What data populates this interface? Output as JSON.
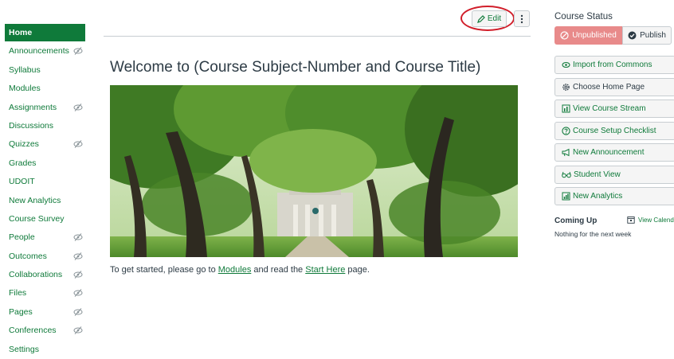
{
  "sidebar": {
    "items": [
      {
        "label": "Home",
        "active": true,
        "hidden": false
      },
      {
        "label": "Announcements",
        "hidden": true
      },
      {
        "label": "Syllabus",
        "hidden": false
      },
      {
        "label": "Modules",
        "hidden": false
      },
      {
        "label": "Assignments",
        "hidden": true
      },
      {
        "label": "Discussions",
        "hidden": false
      },
      {
        "label": "Quizzes",
        "hidden": true
      },
      {
        "label": "Grades",
        "hidden": false
      },
      {
        "label": "UDOIT",
        "hidden": false
      },
      {
        "label": "New Analytics",
        "hidden": false
      },
      {
        "label": "Course Survey",
        "hidden": false
      },
      {
        "label": "People",
        "hidden": true
      },
      {
        "label": "Outcomes",
        "hidden": true
      },
      {
        "label": "Collaborations",
        "hidden": true
      },
      {
        "label": "Files",
        "hidden": true
      },
      {
        "label": "Pages",
        "hidden": true
      },
      {
        "label": "Conferences",
        "hidden": true
      },
      {
        "label": "Settings",
        "hidden": false
      }
    ]
  },
  "toolbar": {
    "edit_label": "Edit",
    "edit_icon": "pencil-icon",
    "more_icon": "kebab-icon"
  },
  "main": {
    "title": "Welcome to (Course Subject-Number and Course Title)",
    "intro": {
      "prefix": "To get started, please go to ",
      "modules_link": "Modules",
      "middle": " and read the ",
      "start_link": "Start Here",
      "suffix": " page."
    }
  },
  "status": {
    "title": "Course Status",
    "unpublished_label": "Unpublished",
    "publish_label": "Publish"
  },
  "actions": [
    {
      "label": "Import from Commons",
      "icon": "commons-icon"
    },
    {
      "label": "Choose Home Page",
      "icon": "gear-icon"
    },
    {
      "label": "View Course Stream",
      "icon": "stream-icon"
    },
    {
      "label": "Course Setup Checklist",
      "icon": "question-icon"
    },
    {
      "label": "New Announcement",
      "icon": "megaphone-icon"
    },
    {
      "label": "Student View",
      "icon": "glasses-icon"
    },
    {
      "label": "New Analytics",
      "icon": "analytics-icon"
    }
  ],
  "coming_up": {
    "title": "Coming Up",
    "calendar_link": "View Calenda",
    "empty_text": "Nothing for the next week"
  },
  "colors": {
    "accent": "#0f7a3a",
    "unpublished": "#e88a8a",
    "highlight_ring": "#d11e2a"
  }
}
